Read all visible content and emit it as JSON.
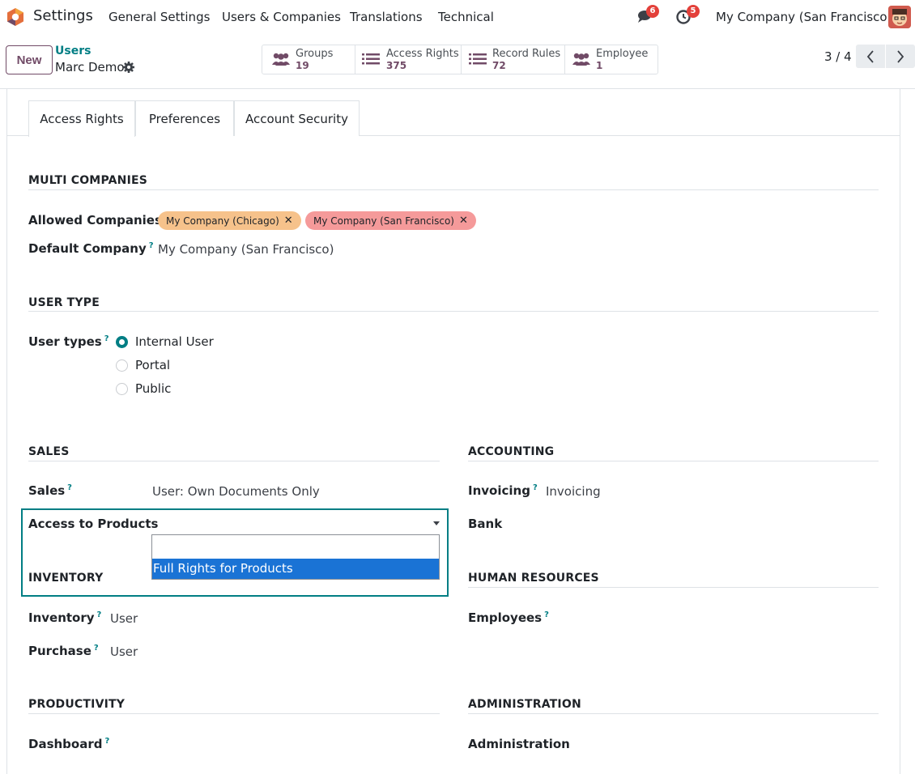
{
  "navbar": {
    "app": "Settings",
    "menus": [
      "General Settings",
      "Users & Companies",
      "Translations",
      "Technical"
    ],
    "messages_badge": "6",
    "activities_badge": "5",
    "company": "My Company (San Francisco)",
    "brand_color": "#714b67"
  },
  "control": {
    "new_label": "New",
    "breadcrumb_parent": "Users",
    "breadcrumb_current": "Marc Demo",
    "smart_buttons": [
      {
        "label": "Groups",
        "value": "19",
        "icon": "users-icon"
      },
      {
        "label": "Access Rights",
        "value": "375",
        "icon": "list-icon"
      },
      {
        "label": "Record Rules",
        "value": "72",
        "icon": "list-icon"
      },
      {
        "label": "Employee",
        "value": "1",
        "icon": "users-icon"
      }
    ],
    "pager": "3 / 4"
  },
  "tabs": [
    "Access Rights",
    "Preferences",
    "Account Security"
  ],
  "multi_companies": {
    "title": "MULTI COMPANIES",
    "allowed_label": "Allowed Companies",
    "allowed": [
      {
        "name": "My Company (Chicago)",
        "color": "#f6c28b"
      },
      {
        "name": "My Company (San Francisco)",
        "color": "#f59a9a"
      }
    ],
    "default_label": "Default Company",
    "default_value": "My Company (San Francisco)"
  },
  "user_type": {
    "title": "USER TYPE",
    "label": "User types",
    "options": [
      "Internal User",
      "Portal",
      "Public"
    ],
    "selected": "Internal User"
  },
  "sales": {
    "title": "SALES",
    "sales_label": "Sales",
    "sales_value": "User: Own Documents Only",
    "products_label": "Access to Products",
    "dropdown_option": "Full Rights for Products"
  },
  "accounting": {
    "title": "ACCOUNTING",
    "invoicing_label": "Invoicing",
    "invoicing_value": "Invoicing",
    "bank_label": "Bank"
  },
  "inventory": {
    "title": "INVENTORY",
    "inventory_label": "Inventory",
    "inventory_value": "User",
    "purchase_label": "Purchase",
    "purchase_value": "User"
  },
  "human_resources": {
    "title": "HUMAN RESOURCES",
    "employees_label": "Employees"
  },
  "productivity": {
    "title": "PRODUCTIVITY",
    "dashboard_label": "Dashboard"
  },
  "administration": {
    "title": "ADMINISTRATION",
    "admin_label": "Administration"
  },
  "help_mark": "?"
}
